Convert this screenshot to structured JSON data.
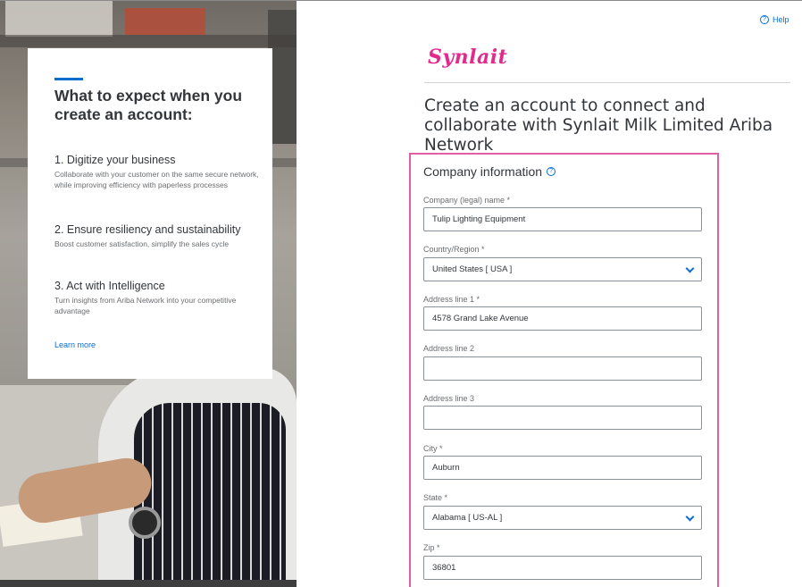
{
  "help": {
    "label": "Help"
  },
  "left_panel": {
    "title": "What to expect when you create an account:",
    "items": [
      {
        "heading": "1. Digitize your business",
        "text": "Collaborate with your customer on the same secure network, while improving efficiency with paperless processes"
      },
      {
        "heading": "2. Ensure resiliency and sustainability",
        "text": "Boost customer satisfaction, simplify the sales cycle"
      },
      {
        "heading": "3. Act with Intelligence",
        "text": "Turn insights from Ariba Network into your competitive advantage"
      }
    ],
    "learn_more": "Learn more"
  },
  "brand": {
    "logo_text": "Synlait",
    "color": "#e4298c"
  },
  "headline": "Create an account to connect and collaborate with Synlait Milk Limited Ariba Network",
  "form": {
    "section_title": "Company information",
    "fields": {
      "company_name": {
        "label": "Company (legal) name *",
        "value": "Tulip Lighting Equipment"
      },
      "country": {
        "label": "Country/Region *",
        "value": "United States [ USA ]"
      },
      "address1": {
        "label": "Address line 1 *",
        "value": "4578 Grand Lake Avenue"
      },
      "address2": {
        "label": "Address line 2",
        "value": ""
      },
      "address3": {
        "label": "Address line 3",
        "value": ""
      },
      "city": {
        "label": "City *",
        "value": "Auburn"
      },
      "state": {
        "label": "State *",
        "value": "Alabama [ US-AL ]"
      },
      "zip": {
        "label": "Zip *",
        "value": "36801"
      }
    }
  },
  "colors": {
    "accent_blue": "#0a6ed1",
    "form_border": "#e060a6"
  }
}
